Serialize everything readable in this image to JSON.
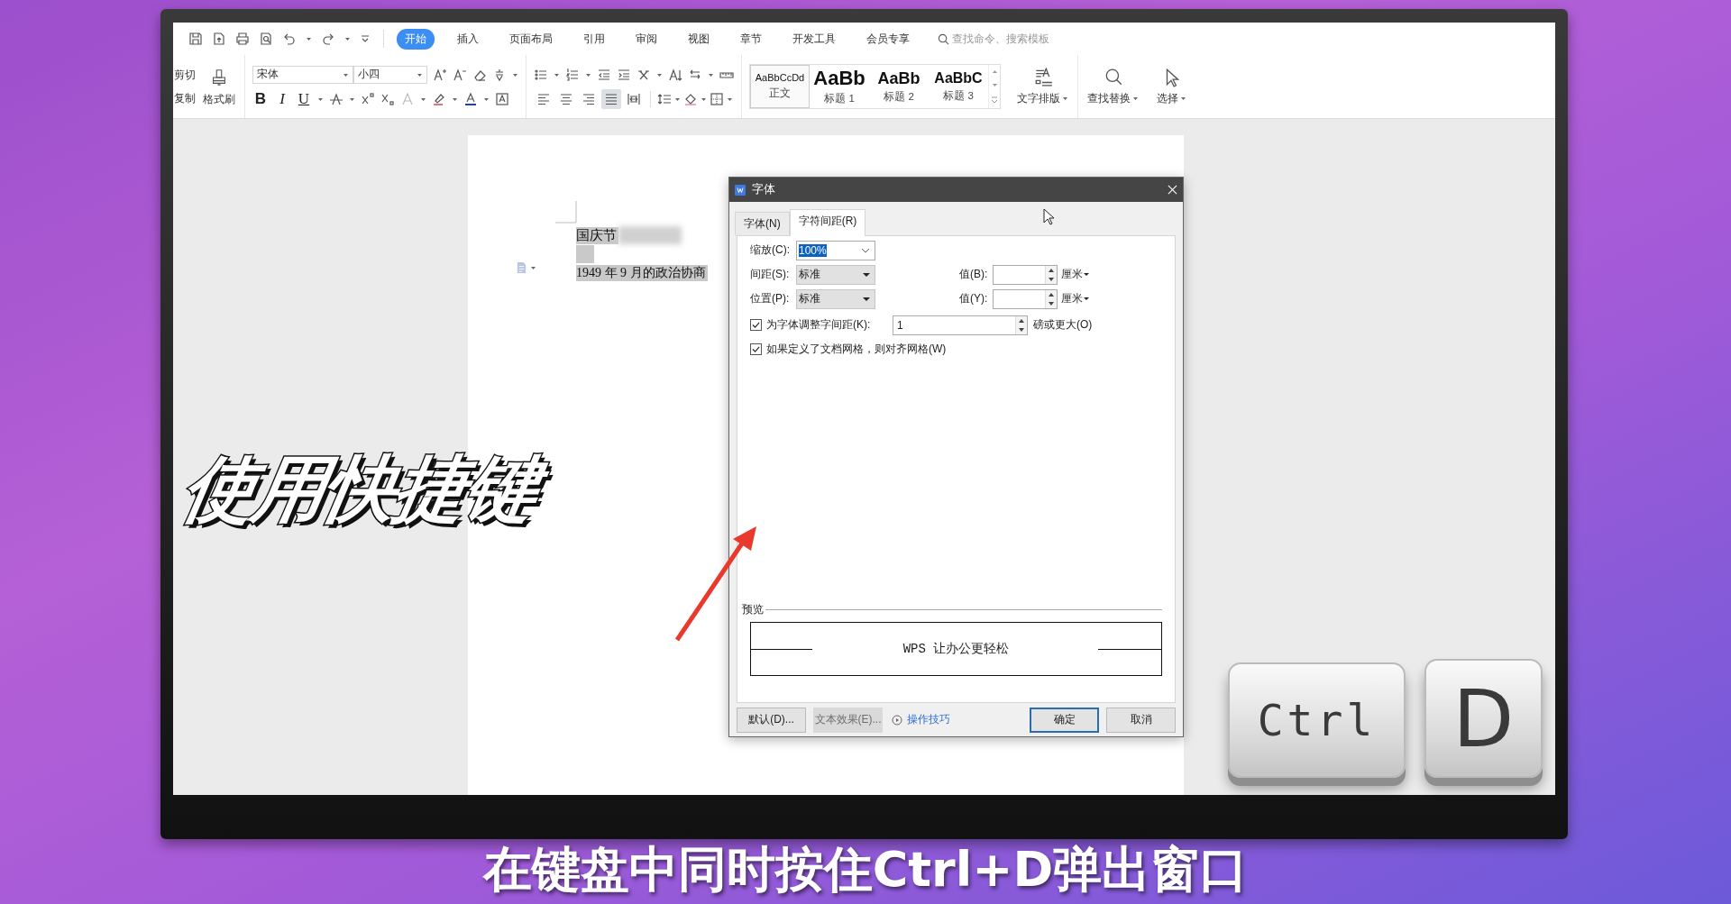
{
  "toolbar": {
    "tabs": [
      {
        "label": "开始",
        "selected": true
      },
      {
        "label": "插入",
        "selected": false
      },
      {
        "label": "页面布局",
        "selected": false
      },
      {
        "label": "引用",
        "selected": false
      },
      {
        "label": "审阅",
        "selected": false
      },
      {
        "label": "视图",
        "selected": false
      },
      {
        "label": "章节",
        "selected": false
      },
      {
        "label": "开发工具",
        "selected": false
      },
      {
        "label": "会员专享",
        "selected": false
      }
    ],
    "search": {
      "placeholder": "查找命令、搜索模板"
    },
    "clipboard": {
      "cut": "剪切",
      "copy": "复制",
      "format_painter": "格式刷"
    },
    "font": {
      "name": "宋体",
      "size": "小四"
    },
    "text_style_buttons": [
      {
        "label": "B",
        "kind": "bold"
      },
      {
        "label": "I",
        "kind": "italic"
      },
      {
        "label": "U",
        "kind": "underline"
      }
    ],
    "align_buttons": [
      {
        "kind": "left",
        "selected": false
      },
      {
        "kind": "center",
        "selected": false
      },
      {
        "kind": "right",
        "selected": false
      },
      {
        "kind": "justify",
        "selected": true
      },
      {
        "kind": "distributed",
        "selected": false
      }
    ],
    "styles": [
      {
        "sample": "AaBbCcDd",
        "name": "正文",
        "kind": "body",
        "selected": true
      },
      {
        "sample": "AaBb",
        "name": "标题 1",
        "kind": "heading1",
        "selected": false
      },
      {
        "sample": "AaBb",
        "name": "标题 2",
        "kind": "heading2",
        "selected": false
      },
      {
        "sample": "AaBbC",
        "name": "标题 3",
        "kind": "heading3",
        "selected": false
      }
    ],
    "tools": [
      {
        "kind": "layout",
        "label": "文字排版"
      },
      {
        "kind": "find",
        "label": "查找替换"
      },
      {
        "kind": "select",
        "label": "选择"
      }
    ]
  },
  "document": {
    "lines": [
      {
        "text": "国庆节",
        "blurred": true
      },
      {
        "text": "1949 年 9 月的政治协商",
        "blurred": false
      }
    ]
  },
  "dialog": {
    "title": "字体",
    "tabs": [
      {
        "label": "字体(N)",
        "selected": false
      },
      {
        "label": "字符间距(R)",
        "selected": true
      }
    ],
    "scale": {
      "label": "缩放(C):",
      "value": "100%",
      "highlighted": true
    },
    "rows": [
      {
        "label": "间距(S):",
        "value": "标准",
        "value_label": "值(B):",
        "unit": "厘米"
      },
      {
        "label": "位置(P):",
        "value": "标准",
        "value_label": "值(Y):",
        "unit": "厘米"
      }
    ],
    "kerning": {
      "label": "为字体调整字间距(K):",
      "checked": true,
      "value": "1",
      "suffix": "磅或更大(O)"
    },
    "snap_to_grid": {
      "label": "如果定义了文档网格，则对齐网格(W)",
      "checked": true
    },
    "preview": {
      "label": "预览",
      "text": "WPS 让办公更轻松"
    },
    "buttons": [
      {
        "label": "默认(D)...",
        "kind": "left",
        "disabled": false,
        "default": false
      },
      {
        "label": "文本效果(E)...",
        "kind": "left",
        "disabled": true,
        "default": false
      },
      {
        "label": "确定",
        "kind": "right",
        "disabled": false,
        "default": true
      },
      {
        "label": "取消",
        "kind": "right",
        "disabled": false,
        "default": false
      }
    ],
    "tips_link": "操作技巧"
  },
  "overlay": {
    "caption": "使用快捷键",
    "subtitle": "在键盘中同时按住Ctrl+D弹出窗口",
    "keys": [
      {
        "label": "Ctrl",
        "kind": "wide"
      },
      {
        "label": "D",
        "kind": "square"
      }
    ]
  }
}
